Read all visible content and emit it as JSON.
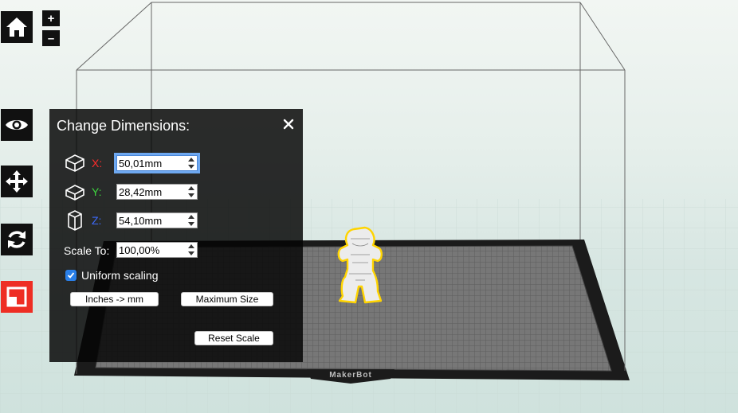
{
  "toolbar": {
    "zoom_in": "+",
    "zoom_out": "–",
    "active_color": "#ee2e24"
  },
  "panel": {
    "title": "Change Dimensions:",
    "dimensions": [
      {
        "axis": "X:",
        "value": "50,01mm",
        "color": "#ff2b2b"
      },
      {
        "axis": "Y:",
        "value": "28,42mm",
        "color": "#3fd63f"
      },
      {
        "axis": "Z:",
        "value": "54,10mm",
        "color": "#3d6bff"
      }
    ],
    "scale_to_label": "Scale To:",
    "scale_to_value": "100,00%",
    "uniform_scaling_label": "Uniform scaling",
    "uniform_scaling_checked": true,
    "inches_button": "Inches -> mm",
    "max_size_button": "Maximum Size",
    "reset_button": "Reset Scale"
  },
  "viewport": {
    "plate_brand": "MakerBot",
    "selection_color": "#ffd400"
  }
}
